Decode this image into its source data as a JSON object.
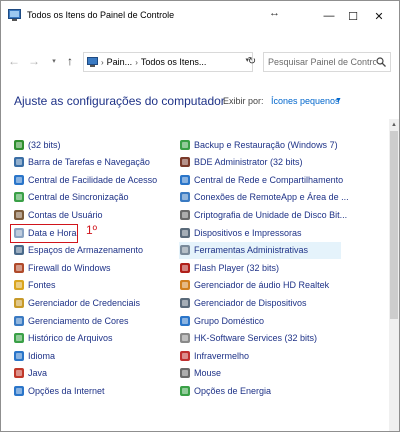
{
  "window": {
    "title": "Todos os Itens do Painel de Controle",
    "resize_glyph": "↔",
    "min_glyph": "—",
    "max_glyph": "☐",
    "close_glyph": "✕"
  },
  "nav": {
    "back": "←",
    "forward": "→",
    "history": "▾",
    "up": "↑",
    "crumbs": [
      "Pain...",
      "Todos os Itens..."
    ],
    "refresh": "↻",
    "address_dropdown": "▾",
    "search_placeholder": "Pesquisar Painel de Controle"
  },
  "content": {
    "heading": "Ajuste as configurações do computador",
    "view_by_label": "Exibir por:",
    "view_by_value": "Ícones pequenos",
    "view_by_caret": "▼",
    "annotation": "1º",
    "scroll_up": "▲"
  },
  "left_items": [
    {
      "label": "(32 bits)",
      "icon": "java-icon",
      "color": "#2f8f2f"
    },
    {
      "label": "Barra de Tarefas e Navegação",
      "icon": "taskbar-icon",
      "color": "#3a6ea5"
    },
    {
      "label": "Central de Facilidade de Acesso",
      "icon": "accessibility-icon",
      "color": "#2a75c9"
    },
    {
      "label": "Central de Sincronização",
      "icon": "sync-icon",
      "color": "#3aa047"
    },
    {
      "label": "Contas de Usuário",
      "icon": "users-icon",
      "color": "#7a5a3a"
    },
    {
      "label": "Data e Hora",
      "icon": "clock-icon",
      "color": "#8aa3c2"
    },
    {
      "label": "Espaços de Armazenamento",
      "icon": "storage-icon",
      "color": "#4a6a8a"
    },
    {
      "label": "Firewall do Windows",
      "icon": "firewall-icon",
      "color": "#b04a2a"
    },
    {
      "label": "Fontes",
      "icon": "fonts-icon",
      "color": "#d9a520"
    },
    {
      "label": "Gerenciador de Credenciais",
      "icon": "credentials-icon",
      "color": "#c79a2a"
    },
    {
      "label": "Gerenciamento de Cores",
      "icon": "color-management-icon",
      "color": "#3a7ac2"
    },
    {
      "label": "Histórico de Arquivos",
      "icon": "file-history-icon",
      "color": "#3aa047"
    },
    {
      "label": "Idioma",
      "icon": "language-icon",
      "color": "#2a75c9"
    },
    {
      "label": "Java",
      "icon": "java-cup-icon",
      "color": "#c0392b"
    },
    {
      "label": "Opções da Internet",
      "icon": "internet-options-icon",
      "color": "#2a75c9"
    }
  ],
  "right_items": [
    {
      "label": "Backup e Restauração (Windows 7)",
      "icon": "backup-icon",
      "color": "#3aa047"
    },
    {
      "label": "BDE Administrator (32 bits)",
      "icon": "bde-icon",
      "color": "#7a3a2a"
    },
    {
      "label": "Central de Rede e Compartilhamento",
      "icon": "network-icon",
      "color": "#2a75c9"
    },
    {
      "label": "Conexões de RemoteApp e Área de ...",
      "icon": "remoteapp-icon",
      "color": "#3a7ac2"
    },
    {
      "label": "Criptografia de Unidade de Disco Bit...",
      "icon": "bitlocker-icon",
      "color": "#6a6a6a"
    },
    {
      "label": "Dispositivos e Impressoras",
      "icon": "printer-icon",
      "color": "#5a6a7a"
    },
    {
      "label": "Ferramentas Administrativas",
      "icon": "admin-tools-icon",
      "color": "#7a8a9a"
    },
    {
      "label": "Flash Player (32 bits)",
      "icon": "flash-icon",
      "color": "#b0201a"
    },
    {
      "label": "Gerenciador de áudio HD Realtek",
      "icon": "audio-icon",
      "color": "#d08020"
    },
    {
      "label": "Gerenciador de Dispositivos",
      "icon": "device-manager-icon",
      "color": "#5a6a7a"
    },
    {
      "label": "Grupo Doméstico",
      "icon": "homegroup-icon",
      "color": "#2a75c9"
    },
    {
      "label": "HK-Software Services (32 bits)",
      "icon": "hk-software-icon",
      "color": "#8a8a8a"
    },
    {
      "label": "Infravermelho",
      "icon": "infrared-icon",
      "color": "#c03030"
    },
    {
      "label": "Mouse",
      "icon": "mouse-icon",
      "color": "#6a6a6a"
    },
    {
      "label": "Opções de Energia",
      "icon": "power-icon",
      "color": "#3aa047"
    }
  ],
  "colors": {
    "link": "#1e3287",
    "accent": "#0066cc",
    "highlight": "#d0141b",
    "hover": "#e5f3fb"
  }
}
